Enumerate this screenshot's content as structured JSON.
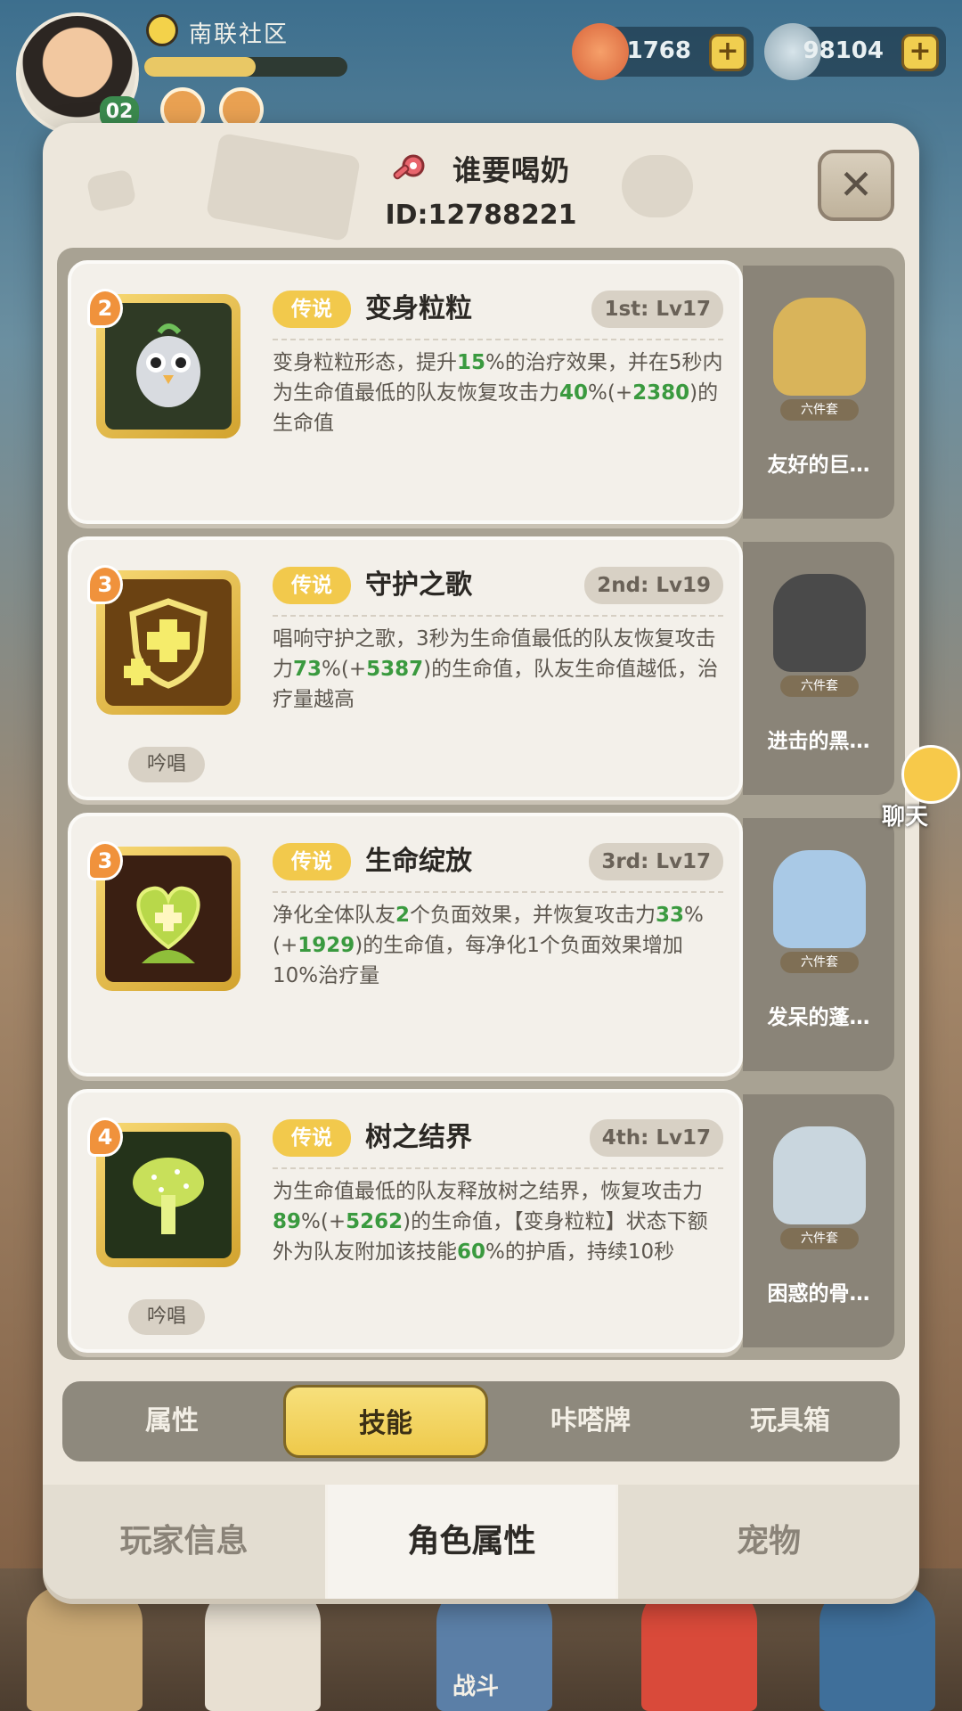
{
  "hud": {
    "avatar_level": "02",
    "guild_name": "南联社区",
    "exp_progress": 0.55,
    "currency_1": "1768",
    "currency_2": "98104"
  },
  "panel": {
    "player_name": "谁要喝奶",
    "player_id": "ID:12788221"
  },
  "skills": [
    {
      "badge": "2",
      "rarity": "传说",
      "name": "变身粒粒",
      "rank": "1st: Lv17",
      "chant": "",
      "desc_parts": [
        {
          "t": "变身粒粒形态，提升"
        },
        {
          "t": "15",
          "g": true
        },
        {
          "t": "%的治疗效果，并在5秒内为生命值最低的队友恢复攻击力"
        },
        {
          "t": "40",
          "g": true
        },
        {
          "t": "%(+"
        },
        {
          "t": "2380",
          "g": true
        },
        {
          "t": ")的生命值"
        }
      ],
      "pet_name": "友好的巨…",
      "pet_tag": "六件套",
      "icon_color": "#2f3a25"
    },
    {
      "badge": "3",
      "rarity": "传说",
      "name": "守护之歌",
      "rank": "2nd: Lv19",
      "chant": "吟唱",
      "desc_parts": [
        {
          "t": "唱响守护之歌，3秒为生命值最低的队友恢复攻击力"
        },
        {
          "t": "73",
          "g": true
        },
        {
          "t": "%(+"
        },
        {
          "t": "5387",
          "g": true
        },
        {
          "t": ")的生命值，队友生命值越低，治疗量越高"
        }
      ],
      "pet_name": "进击的黑…",
      "pet_tag": "六件套",
      "icon_color": "#6b4212"
    },
    {
      "badge": "3",
      "rarity": "传说",
      "name": "生命绽放",
      "rank": "3rd: Lv17",
      "chant": "",
      "desc_parts": [
        {
          "t": "净化全体队友"
        },
        {
          "t": "2",
          "g": true
        },
        {
          "t": "个负面效果，并恢复攻击力"
        },
        {
          "t": "33",
          "g": true
        },
        {
          "t": "%(+"
        },
        {
          "t": "1929",
          "g": true
        },
        {
          "t": ")的生命值，每净化1个负面效果增加10%治疗量"
        }
      ],
      "pet_name": "发呆的蓬…",
      "pet_tag": "六件套",
      "icon_color": "#3a1f12"
    },
    {
      "badge": "4",
      "rarity": "传说",
      "name": "树之结界",
      "rank": "4th: Lv17",
      "chant": "吟唱",
      "desc_parts": [
        {
          "t": "为生命值最低的队友释放树之结界，恢复攻击力"
        },
        {
          "t": "89",
          "g": true
        },
        {
          "t": "%(+"
        },
        {
          "t": "5262",
          "g": true
        },
        {
          "t": ")的生命值，【变身粒粒】状态下额外为队友附加该技能"
        },
        {
          "t": "60",
          "g": true
        },
        {
          "t": "%的护盾，持续10秒"
        }
      ],
      "pet_name": "困惑的骨…",
      "pet_tag": "六件套",
      "icon_color": "#24331a"
    }
  ],
  "tabs": [
    "属性",
    "技能",
    "咔嗒牌",
    "玩具箱"
  ],
  "active_tab": 1,
  "bottom_tabs": [
    "玩家信息",
    "角色属性",
    "宠物"
  ],
  "active_bottom_tab": 1,
  "chat_label": "聊天",
  "battle_label": "战斗",
  "colors": {
    "highlight_green": "#3a9a3f",
    "rarity_gold": "#f2c94c",
    "active_tab_yellow": "#f0cf55"
  }
}
